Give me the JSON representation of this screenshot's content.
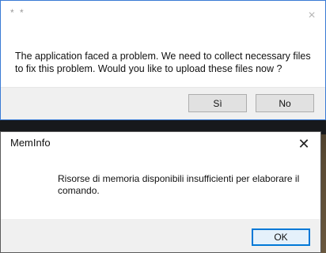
{
  "dialog1": {
    "title": "* *",
    "close_icon": "×",
    "message": "The application faced a problem. We need to collect necessary files to fix this problem. Would you like to upload these files now ?",
    "yes_label": "Sì",
    "no_label": "No"
  },
  "dialog2": {
    "title": "MemInfo",
    "close_icon": "✕",
    "message": "Risorse di memoria disponibili insufficienti per elaborare il comando.",
    "ok_label": "OK"
  }
}
